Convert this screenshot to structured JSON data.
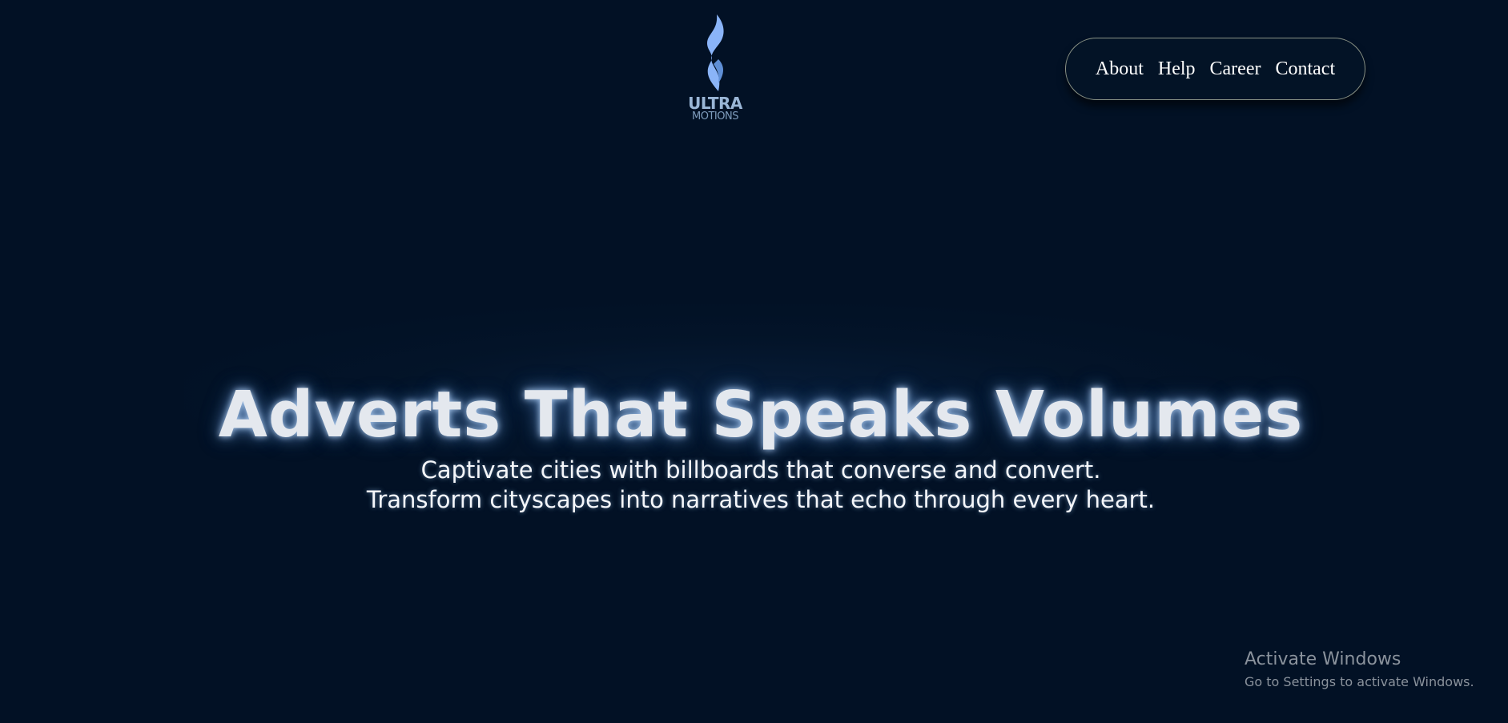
{
  "logo": {
    "line1": "ULTRA",
    "line2": "MOTIONS",
    "icon": "flame-icon",
    "color": "#8ab4f8"
  },
  "nav": {
    "items": [
      {
        "label": "About"
      },
      {
        "label": "Help"
      },
      {
        "label": "Career"
      },
      {
        "label": "Contact"
      }
    ]
  },
  "hero": {
    "title": "Adverts That Speaks Volumes",
    "subtitle_line1": "Captivate cities with billboards that converse and convert.",
    "subtitle_line2": "Transform cityscapes into narratives that echo through every heart."
  },
  "watermark": {
    "title": "Activate Windows",
    "subtitle": "Go to Settings to activate Windows."
  },
  "colors": {
    "background": "#021125",
    "nav_border": "#8a9386",
    "text": "#ffffff"
  }
}
